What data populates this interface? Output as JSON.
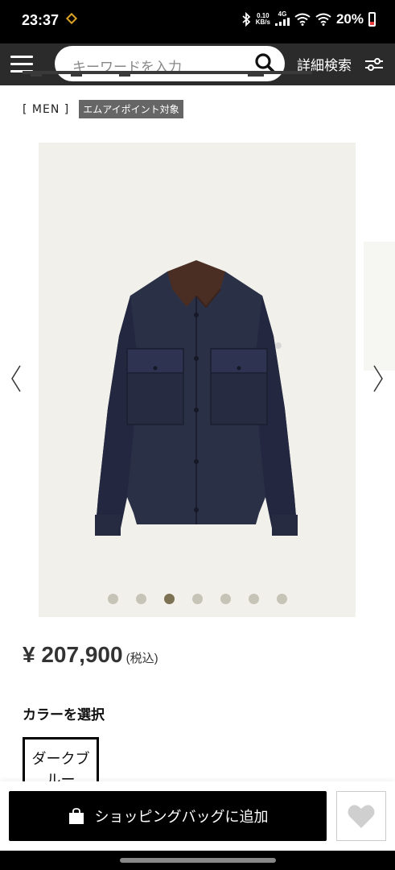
{
  "status_bar": {
    "time": "23:37",
    "net_speed_value": "0.10",
    "net_speed_unit": "KB/s",
    "network_type": "4G",
    "battery": "20%"
  },
  "header": {
    "search_placeholder": "キーワードを入力",
    "advanced_search_label": "詳細検索"
  },
  "product": {
    "gender_tag": "MEN",
    "badge": "エムアイポイント対象",
    "image_pager": {
      "total": 7,
      "active_index": 2
    },
    "price": "¥ 207,900",
    "tax_note": "(税込)",
    "color_section_label": "カラーを選択",
    "color_option": "ダークブルー"
  },
  "actions": {
    "add_to_bag_label": "ショッピングバッグに追加"
  },
  "colors": {
    "header_bg": "#2b2b2b",
    "image_bg": "#f1f0ea",
    "dot_active": "#7d7154",
    "dot_inactive": "#c6c3b7"
  }
}
